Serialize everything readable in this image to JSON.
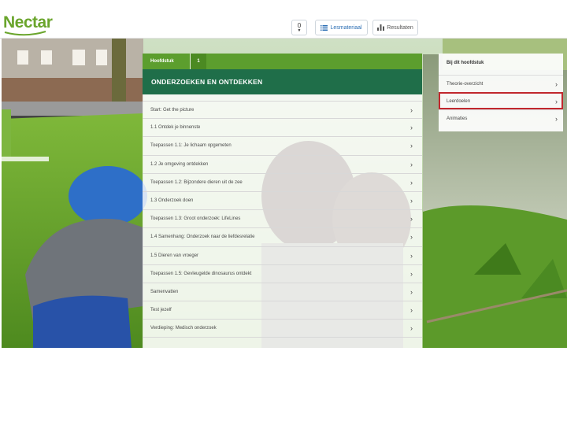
{
  "topbar": {
    "logo": "Nectar",
    "counter": "0",
    "lesmateriaal_label": "Lesmateriaal",
    "resultaten_label": "Resultaten"
  },
  "chapter": {
    "tab_label": "Hoofdstuk",
    "tab_number": "1",
    "title": "ONDERZOEKEN EN ONTDEKKEN",
    "items": [
      {
        "label": "Start: Get the picture"
      },
      {
        "label": "1.1 Ontdek je binnenste"
      },
      {
        "label": "Toepassen 1.1: Je lichaam opgemeten"
      },
      {
        "label": "1.2 Je omgeving ontdekken"
      },
      {
        "label": "Toepassen 1.2: Bijzondere dieren uit de zee"
      },
      {
        "label": "1.3 Onderzoek doen"
      },
      {
        "label": "Toepassen 1.3: Groot onderzoek: LifeLines"
      },
      {
        "label": "1.4 Samenhang: Onderzoek naar de liefdesrelatie"
      },
      {
        "label": "1.5 Dieren van vroeger"
      },
      {
        "label": "Toepassen 1.5: Gevleugelde dinosaurus ontdekt"
      },
      {
        "label": "Samenvatten"
      },
      {
        "label": "Test jezelf"
      },
      {
        "label": "Verdieping: Medisch onderzoek"
      }
    ]
  },
  "sidebar": {
    "title": "Bij dit hoofdstuk",
    "items": [
      {
        "label": "Theorie-overzicht"
      },
      {
        "label": "Leerdoelen",
        "active": true
      },
      {
        "label": "Animaties"
      }
    ]
  },
  "colors": {
    "brand_green": "#6aa52c",
    "tab_green": "#5c9e2e",
    "header_green": "#1f6e49",
    "highlight_red": "#c1272d"
  }
}
